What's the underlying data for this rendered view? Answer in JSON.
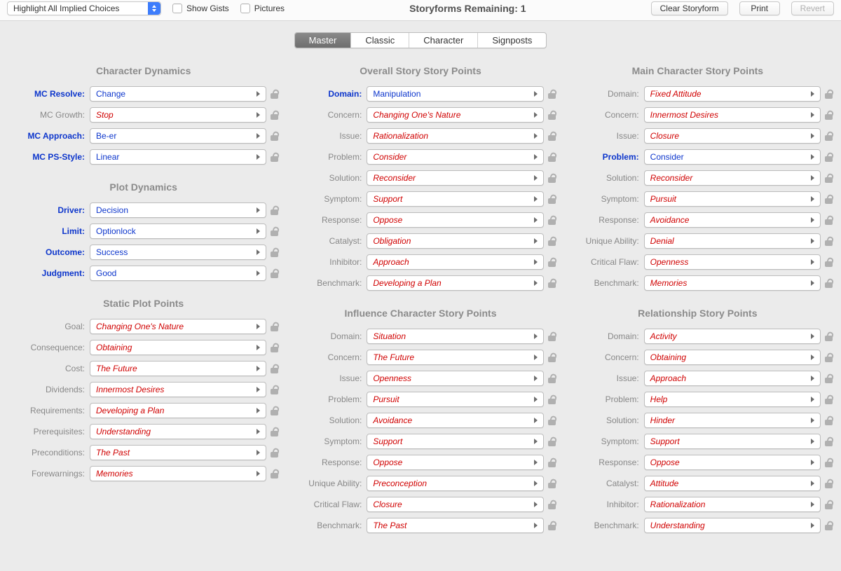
{
  "toolbar": {
    "highlight_mode": "Highlight All Implied Choices",
    "show_gists_label": "Show Gists",
    "pictures_label": "Pictures",
    "title": "Storyforms Remaining: 1",
    "clear_label": "Clear Storyform",
    "print_label": "Print",
    "revert_label": "Revert"
  },
  "tabs": {
    "master": "Master",
    "classic": "Classic",
    "character": "Character",
    "signposts": "Signposts"
  },
  "sections": {
    "char_dyn_title": "Character Dynamics",
    "plot_dyn_title": "Plot Dynamics",
    "static_title": "Static Plot Points",
    "os_title": "Overall Story Story Points",
    "mc_title": "Main Character Story Points",
    "ic_title": "Influence Character Story Points",
    "rs_title": "Relationship Story Points"
  },
  "char_dyn": [
    {
      "label": "MC Resolve:",
      "value": "Change",
      "label_blue": true,
      "val_color": "blue"
    },
    {
      "label": "MC Growth:",
      "value": "Stop",
      "label_blue": false,
      "val_color": "red"
    },
    {
      "label": "MC Approach:",
      "value": "Be-er",
      "label_blue": true,
      "val_color": "blue"
    },
    {
      "label": "MC PS-Style:",
      "value": "Linear",
      "label_blue": true,
      "val_color": "blue"
    }
  ],
  "plot_dyn": [
    {
      "label": "Driver:",
      "value": "Decision",
      "label_blue": true,
      "val_color": "blue"
    },
    {
      "label": "Limit:",
      "value": "Optionlock",
      "label_blue": true,
      "val_color": "blue"
    },
    {
      "label": "Outcome:",
      "value": "Success",
      "label_blue": true,
      "val_color": "blue"
    },
    {
      "label": "Judgment:",
      "value": "Good",
      "label_blue": true,
      "val_color": "blue"
    }
  ],
  "static_plot": [
    {
      "label": "Goal:",
      "value": "Changing One's Nature",
      "val_color": "red"
    },
    {
      "label": "Consequence:",
      "value": "Obtaining",
      "val_color": "red"
    },
    {
      "label": "Cost:",
      "value": "The Future",
      "val_color": "red"
    },
    {
      "label": "Dividends:",
      "value": "Innermost Desires",
      "val_color": "red"
    },
    {
      "label": "Requirements:",
      "value": "Developing a Plan",
      "val_color": "red"
    },
    {
      "label": "Prerequisites:",
      "value": "Understanding",
      "val_color": "red"
    },
    {
      "label": "Preconditions:",
      "value": "The Past",
      "val_color": "red"
    },
    {
      "label": "Forewarnings:",
      "value": "Memories",
      "val_color": "red"
    }
  ],
  "os": [
    {
      "label": "Domain:",
      "value": "Manipulation",
      "label_blue": true,
      "val_color": "blue"
    },
    {
      "label": "Concern:",
      "value": "Changing One's Nature",
      "val_color": "red"
    },
    {
      "label": "Issue:",
      "value": "Rationalization",
      "val_color": "red"
    },
    {
      "label": "Problem:",
      "value": "Consider",
      "val_color": "red"
    },
    {
      "label": "Solution:",
      "value": "Reconsider",
      "val_color": "red"
    },
    {
      "label": "Symptom:",
      "value": "Support",
      "val_color": "red"
    },
    {
      "label": "Response:",
      "value": "Oppose",
      "val_color": "red"
    },
    {
      "label": "Catalyst:",
      "value": "Obligation",
      "val_color": "red"
    },
    {
      "label": "Inhibitor:",
      "value": "Approach",
      "val_color": "red"
    },
    {
      "label": "Benchmark:",
      "value": "Developing a Plan",
      "val_color": "red"
    }
  ],
  "mc": [
    {
      "label": "Domain:",
      "value": "Fixed Attitude",
      "val_color": "red"
    },
    {
      "label": "Concern:",
      "value": "Innermost Desires",
      "val_color": "red"
    },
    {
      "label": "Issue:",
      "value": "Closure",
      "val_color": "red"
    },
    {
      "label": "Problem:",
      "value": "Consider",
      "label_blue": true,
      "val_color": "blue"
    },
    {
      "label": "Solution:",
      "value": "Reconsider",
      "val_color": "red"
    },
    {
      "label": "Symptom:",
      "value": "Pursuit",
      "val_color": "red"
    },
    {
      "label": "Response:",
      "value": "Avoidance",
      "val_color": "red"
    },
    {
      "label": "Unique Ability:",
      "value": "Denial",
      "val_color": "red"
    },
    {
      "label": "Critical Flaw:",
      "value": "Openness",
      "val_color": "red"
    },
    {
      "label": "Benchmark:",
      "value": "Memories",
      "val_color": "red"
    }
  ],
  "ic": [
    {
      "label": "Domain:",
      "value": "Situation",
      "val_color": "red"
    },
    {
      "label": "Concern:",
      "value": "The Future",
      "val_color": "red"
    },
    {
      "label": "Issue:",
      "value": "Openness",
      "val_color": "red"
    },
    {
      "label": "Problem:",
      "value": "Pursuit",
      "val_color": "red"
    },
    {
      "label": "Solution:",
      "value": "Avoidance",
      "val_color": "red"
    },
    {
      "label": "Symptom:",
      "value": "Support",
      "val_color": "red"
    },
    {
      "label": "Response:",
      "value": "Oppose",
      "val_color": "red"
    },
    {
      "label": "Unique Ability:",
      "value": "Preconception",
      "val_color": "red"
    },
    {
      "label": "Critical Flaw:",
      "value": "Closure",
      "val_color": "red"
    },
    {
      "label": "Benchmark:",
      "value": "The Past",
      "val_color": "red"
    }
  ],
  "rs": [
    {
      "label": "Domain:",
      "value": "Activity",
      "val_color": "red"
    },
    {
      "label": "Concern:",
      "value": "Obtaining",
      "val_color": "red"
    },
    {
      "label": "Issue:",
      "value": "Approach",
      "val_color": "red"
    },
    {
      "label": "Problem:",
      "value": "Help",
      "val_color": "red"
    },
    {
      "label": "Solution:",
      "value": "Hinder",
      "val_color": "red"
    },
    {
      "label": "Symptom:",
      "value": "Support",
      "val_color": "red"
    },
    {
      "label": "Response:",
      "value": "Oppose",
      "val_color": "red"
    },
    {
      "label": "Catalyst:",
      "value": "Attitude",
      "val_color": "red"
    },
    {
      "label": "Inhibitor:",
      "value": "Rationalization",
      "val_color": "red"
    },
    {
      "label": "Benchmark:",
      "value": "Understanding",
      "val_color": "red"
    }
  ]
}
